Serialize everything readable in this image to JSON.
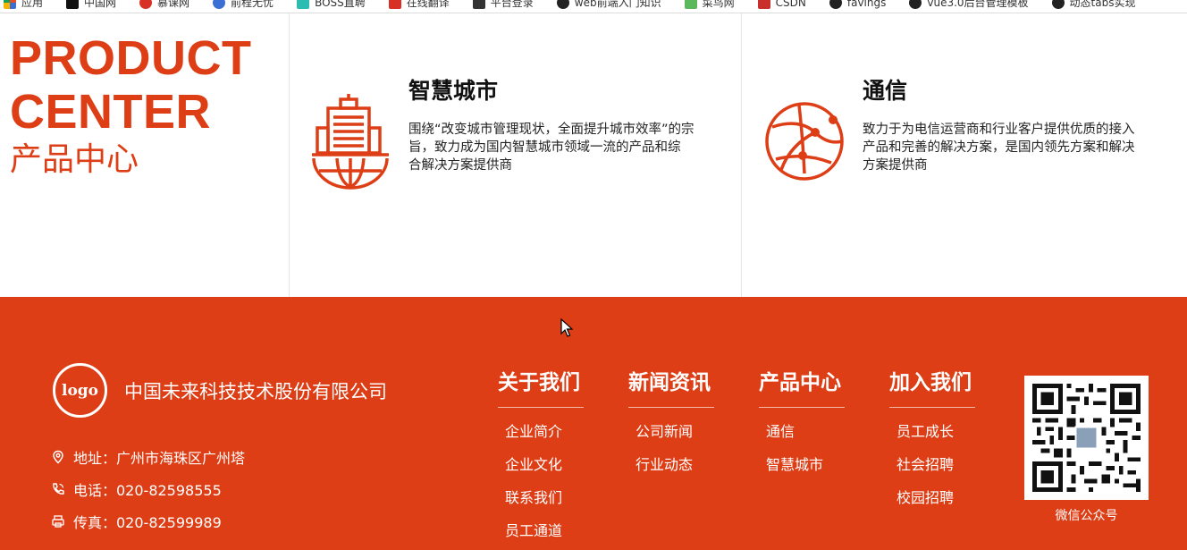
{
  "bookmarks": [
    {
      "label": "应用",
      "icon": "apps-grid-icon",
      "color": "#e44d26"
    },
    {
      "label": "中国网",
      "icon": "site-favicon-icon",
      "color": "#111111"
    },
    {
      "label": "慕课网",
      "icon": "site-favicon-icon",
      "color": "#d93025"
    },
    {
      "label": "前程无忧",
      "icon": "site-favicon-icon",
      "color": "#3b6fd4"
    },
    {
      "label": "BOSS直聘",
      "icon": "site-favicon-icon",
      "color": "#2dbcb2"
    },
    {
      "label": "在线翻译",
      "icon": "site-favicon-icon",
      "color": "#d93025"
    },
    {
      "label": "平台登录",
      "icon": "site-favicon-icon",
      "color": "#333333"
    },
    {
      "label": "web前端入门知识",
      "icon": "github-icon",
      "color": "#222222"
    },
    {
      "label": "菜鸟网",
      "icon": "site-favicon-icon",
      "color": "#5cb85c"
    },
    {
      "label": "CSDN",
      "icon": "site-favicon-icon",
      "color": "#c9302c"
    },
    {
      "label": "favings",
      "icon": "github-icon",
      "color": "#222222"
    },
    {
      "label": "vue3.0后台管理模板",
      "icon": "github-icon",
      "color": "#222222"
    },
    {
      "label": "动态tabs实现",
      "icon": "github-icon",
      "color": "#222222"
    }
  ],
  "product_center": {
    "title_en_line1": "PRODUCT",
    "title_en_line2": "CENTER",
    "title_cn": "产品中心"
  },
  "cards": [
    {
      "icon": "city-building-icon",
      "title": "智慧城市",
      "desc": [
        "围绕“改变城市管理现状，全面提升城市效率”的宗",
        "旨，致力成为国内智慧城市领域一流的产品和综",
        "合解决方案提供商"
      ]
    },
    {
      "icon": "network-globe-icon",
      "title": "通信",
      "desc": [
        "致力于为电信运营商和行业客户提供优质的接入",
        "产品和完善的解决方案，是国内领先方案和解决",
        "方案提供商"
      ]
    }
  ],
  "footer": {
    "logo_text": "logo",
    "company": "中国未来科技技术股份有限公司",
    "contacts": [
      {
        "icon": "location-pin-icon",
        "text": "地址：广州市海珠区广州塔"
      },
      {
        "icon": "phone-icon",
        "text": "电话：020-82598555"
      },
      {
        "icon": "fax-icon",
        "text": "传真：020-82599989"
      }
    ],
    "columns": [
      {
        "title": "关于我们",
        "links": [
          "企业简介",
          "企业文化",
          "联系我们",
          "员工通道"
        ]
      },
      {
        "title": "新闻资讯",
        "links": [
          "公司新闻",
          "行业动态"
        ]
      },
      {
        "title": "产品中心",
        "links": [
          "通信",
          "智慧城市"
        ]
      },
      {
        "title": "加入我们",
        "links": [
          "员工成长",
          "社会招聘",
          "校园招聘"
        ]
      }
    ],
    "qr_label": "微信公众号"
  },
  "colors": {
    "brand": "#dd3e16",
    "text": "#222222",
    "white": "#ffffff"
  }
}
